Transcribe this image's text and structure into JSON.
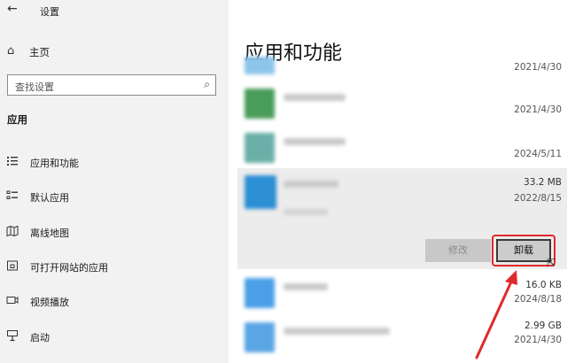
{
  "window": {
    "title": "设置"
  },
  "sidebar": {
    "home_label": "主页",
    "search_placeholder": "查找设置",
    "section_title": "应用",
    "items": [
      {
        "label": "应用和功能",
        "icon": "apps-list-icon"
      },
      {
        "label": "默认应用",
        "icon": "default-apps-icon"
      },
      {
        "label": "离线地图",
        "icon": "offline-maps-icon"
      },
      {
        "label": "可打开网站的应用",
        "icon": "apps-for-websites-icon"
      },
      {
        "label": "视频播放",
        "icon": "video-playback-icon"
      },
      {
        "label": "启动",
        "icon": "startup-icon"
      }
    ]
  },
  "main": {
    "title": "应用和功能",
    "apps": [
      {
        "size": "",
        "date": "2021/4/30",
        "icon_color": "#5aa8e8"
      },
      {
        "size": "",
        "date": "2021/4/30",
        "icon_color": "#4a9c5a"
      },
      {
        "size": "",
        "date": "2024/5/11",
        "icon_color": "#6bb0d8"
      },
      {
        "size": "33.2 MB",
        "date": "2022/8/15",
        "icon_color": "#2c8fd4",
        "expanded": true
      },
      {
        "size": "16.0 KB",
        "date": "2024/8/18",
        "icon_color": "#4a9fe6"
      },
      {
        "size": "2.99 GB",
        "date": "2021/4/30",
        "icon_color": "#5aa5e4"
      }
    ],
    "top_partial_date": "2021/4/30",
    "modify_label": "修改",
    "uninstall_label": "卸载"
  },
  "colors": {
    "highlight": "#e02a2a",
    "sidebar_bg": "#f2f2f2",
    "expanded_bg": "#ececec"
  }
}
